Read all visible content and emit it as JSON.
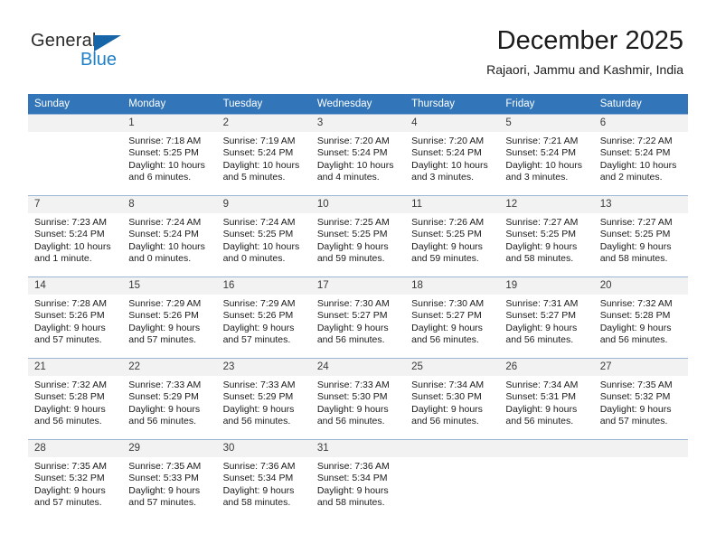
{
  "brand": {
    "name_top": "General",
    "name_bottom": "Blue",
    "accent_color": "#1f80c8",
    "triangle_color": "#1565a8"
  },
  "header": {
    "title": "December 2025",
    "subtitle": "Rajaori, Jammu and Kashmir, India"
  },
  "calendar": {
    "header_bg": "#3275b8",
    "header_text_color": "#ffffff",
    "daynum_bg": "#f2f2f2",
    "weekdays": [
      "Sunday",
      "Monday",
      "Tuesday",
      "Wednesday",
      "Thursday",
      "Friday",
      "Saturday"
    ],
    "weeks": [
      [
        {
          "day": "",
          "sunrise": "",
          "sunset": "",
          "daylight_line1": "",
          "daylight_line2": "",
          "empty": true
        },
        {
          "day": "1",
          "sunrise": "Sunrise: 7:18 AM",
          "sunset": "Sunset: 5:25 PM",
          "daylight_line1": "Daylight: 10 hours",
          "daylight_line2": "and 6 minutes."
        },
        {
          "day": "2",
          "sunrise": "Sunrise: 7:19 AM",
          "sunset": "Sunset: 5:24 PM",
          "daylight_line1": "Daylight: 10 hours",
          "daylight_line2": "and 5 minutes."
        },
        {
          "day": "3",
          "sunrise": "Sunrise: 7:20 AM",
          "sunset": "Sunset: 5:24 PM",
          "daylight_line1": "Daylight: 10 hours",
          "daylight_line2": "and 4 minutes."
        },
        {
          "day": "4",
          "sunrise": "Sunrise: 7:20 AM",
          "sunset": "Sunset: 5:24 PM",
          "daylight_line1": "Daylight: 10 hours",
          "daylight_line2": "and 3 minutes."
        },
        {
          "day": "5",
          "sunrise": "Sunrise: 7:21 AM",
          "sunset": "Sunset: 5:24 PM",
          "daylight_line1": "Daylight: 10 hours",
          "daylight_line2": "and 3 minutes."
        },
        {
          "day": "6",
          "sunrise": "Sunrise: 7:22 AM",
          "sunset": "Sunset: 5:24 PM",
          "daylight_line1": "Daylight: 10 hours",
          "daylight_line2": "and 2 minutes."
        }
      ],
      [
        {
          "day": "7",
          "sunrise": "Sunrise: 7:23 AM",
          "sunset": "Sunset: 5:24 PM",
          "daylight_line1": "Daylight: 10 hours",
          "daylight_line2": "and 1 minute."
        },
        {
          "day": "8",
          "sunrise": "Sunrise: 7:24 AM",
          "sunset": "Sunset: 5:24 PM",
          "daylight_line1": "Daylight: 10 hours",
          "daylight_line2": "and 0 minutes."
        },
        {
          "day": "9",
          "sunrise": "Sunrise: 7:24 AM",
          "sunset": "Sunset: 5:25 PM",
          "daylight_line1": "Daylight: 10 hours",
          "daylight_line2": "and 0 minutes."
        },
        {
          "day": "10",
          "sunrise": "Sunrise: 7:25 AM",
          "sunset": "Sunset: 5:25 PM",
          "daylight_line1": "Daylight: 9 hours",
          "daylight_line2": "and 59 minutes."
        },
        {
          "day": "11",
          "sunrise": "Sunrise: 7:26 AM",
          "sunset": "Sunset: 5:25 PM",
          "daylight_line1": "Daylight: 9 hours",
          "daylight_line2": "and 59 minutes."
        },
        {
          "day": "12",
          "sunrise": "Sunrise: 7:27 AM",
          "sunset": "Sunset: 5:25 PM",
          "daylight_line1": "Daylight: 9 hours",
          "daylight_line2": "and 58 minutes."
        },
        {
          "day": "13",
          "sunrise": "Sunrise: 7:27 AM",
          "sunset": "Sunset: 5:25 PM",
          "daylight_line1": "Daylight: 9 hours",
          "daylight_line2": "and 58 minutes."
        }
      ],
      [
        {
          "day": "14",
          "sunrise": "Sunrise: 7:28 AM",
          "sunset": "Sunset: 5:26 PM",
          "daylight_line1": "Daylight: 9 hours",
          "daylight_line2": "and 57 minutes."
        },
        {
          "day": "15",
          "sunrise": "Sunrise: 7:29 AM",
          "sunset": "Sunset: 5:26 PM",
          "daylight_line1": "Daylight: 9 hours",
          "daylight_line2": "and 57 minutes."
        },
        {
          "day": "16",
          "sunrise": "Sunrise: 7:29 AM",
          "sunset": "Sunset: 5:26 PM",
          "daylight_line1": "Daylight: 9 hours",
          "daylight_line2": "and 57 minutes."
        },
        {
          "day": "17",
          "sunrise": "Sunrise: 7:30 AM",
          "sunset": "Sunset: 5:27 PM",
          "daylight_line1": "Daylight: 9 hours",
          "daylight_line2": "and 56 minutes."
        },
        {
          "day": "18",
          "sunrise": "Sunrise: 7:30 AM",
          "sunset": "Sunset: 5:27 PM",
          "daylight_line1": "Daylight: 9 hours",
          "daylight_line2": "and 56 minutes."
        },
        {
          "day": "19",
          "sunrise": "Sunrise: 7:31 AM",
          "sunset": "Sunset: 5:27 PM",
          "daylight_line1": "Daylight: 9 hours",
          "daylight_line2": "and 56 minutes."
        },
        {
          "day": "20",
          "sunrise": "Sunrise: 7:32 AM",
          "sunset": "Sunset: 5:28 PM",
          "daylight_line1": "Daylight: 9 hours",
          "daylight_line2": "and 56 minutes."
        }
      ],
      [
        {
          "day": "21",
          "sunrise": "Sunrise: 7:32 AM",
          "sunset": "Sunset: 5:28 PM",
          "daylight_line1": "Daylight: 9 hours",
          "daylight_line2": "and 56 minutes."
        },
        {
          "day": "22",
          "sunrise": "Sunrise: 7:33 AM",
          "sunset": "Sunset: 5:29 PM",
          "daylight_line1": "Daylight: 9 hours",
          "daylight_line2": "and 56 minutes."
        },
        {
          "day": "23",
          "sunrise": "Sunrise: 7:33 AM",
          "sunset": "Sunset: 5:29 PM",
          "daylight_line1": "Daylight: 9 hours",
          "daylight_line2": "and 56 minutes."
        },
        {
          "day": "24",
          "sunrise": "Sunrise: 7:33 AM",
          "sunset": "Sunset: 5:30 PM",
          "daylight_line1": "Daylight: 9 hours",
          "daylight_line2": "and 56 minutes."
        },
        {
          "day": "25",
          "sunrise": "Sunrise: 7:34 AM",
          "sunset": "Sunset: 5:30 PM",
          "daylight_line1": "Daylight: 9 hours",
          "daylight_line2": "and 56 minutes."
        },
        {
          "day": "26",
          "sunrise": "Sunrise: 7:34 AM",
          "sunset": "Sunset: 5:31 PM",
          "daylight_line1": "Daylight: 9 hours",
          "daylight_line2": "and 56 minutes."
        },
        {
          "day": "27",
          "sunrise": "Sunrise: 7:35 AM",
          "sunset": "Sunset: 5:32 PM",
          "daylight_line1": "Daylight: 9 hours",
          "daylight_line2": "and 57 minutes."
        }
      ],
      [
        {
          "day": "28",
          "sunrise": "Sunrise: 7:35 AM",
          "sunset": "Sunset: 5:32 PM",
          "daylight_line1": "Daylight: 9 hours",
          "daylight_line2": "and 57 minutes."
        },
        {
          "day": "29",
          "sunrise": "Sunrise: 7:35 AM",
          "sunset": "Sunset: 5:33 PM",
          "daylight_line1": "Daylight: 9 hours",
          "daylight_line2": "and 57 minutes."
        },
        {
          "day": "30",
          "sunrise": "Sunrise: 7:36 AM",
          "sunset": "Sunset: 5:34 PM",
          "daylight_line1": "Daylight: 9 hours",
          "daylight_line2": "and 58 minutes."
        },
        {
          "day": "31",
          "sunrise": "Sunrise: 7:36 AM",
          "sunset": "Sunset: 5:34 PM",
          "daylight_line1": "Daylight: 9 hours",
          "daylight_line2": "and 58 minutes."
        },
        {
          "day": "",
          "sunrise": "",
          "sunset": "",
          "daylight_line1": "",
          "daylight_line2": "",
          "empty": true
        },
        {
          "day": "",
          "sunrise": "",
          "sunset": "",
          "daylight_line1": "",
          "daylight_line2": "",
          "empty": true
        },
        {
          "day": "",
          "sunrise": "",
          "sunset": "",
          "daylight_line1": "",
          "daylight_line2": "",
          "empty": true
        }
      ]
    ]
  }
}
